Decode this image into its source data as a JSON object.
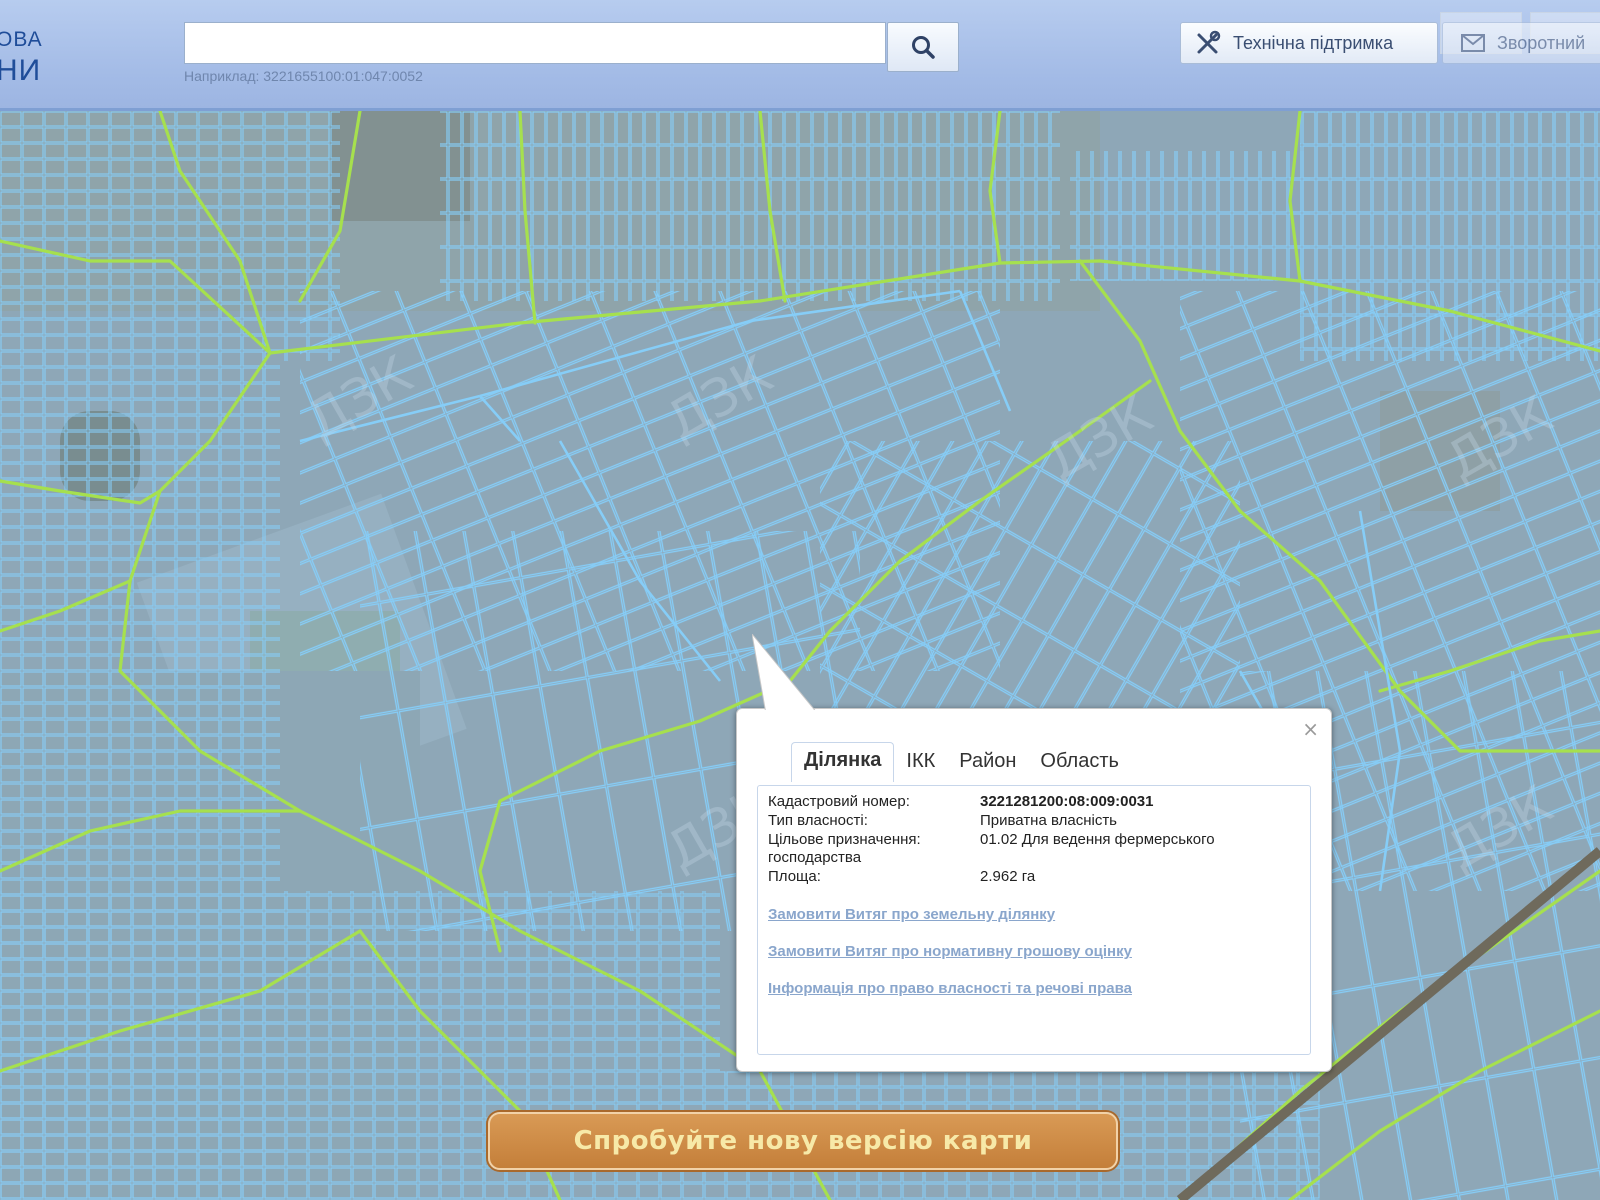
{
  "header": {
    "logo_line1": "ОВА",
    "logo_line2": "НИ",
    "search": {
      "value": "",
      "placeholder": ""
    },
    "search_hint": "Наприклад: 3221655100:01:047:0052",
    "support_label": "Технічна підтримка",
    "feedback_label": "Зворотний"
  },
  "popup": {
    "close": "×",
    "tabs": [
      {
        "label": "Ділянка",
        "active": true
      },
      {
        "label": "ІКК",
        "active": false
      },
      {
        "label": "Район",
        "active": false
      },
      {
        "label": "Область",
        "active": false
      }
    ],
    "fields": [
      {
        "label": "Кадастровий номер:",
        "value": "3221281200:08:009:0031"
      },
      {
        "label": "Тип власності:",
        "value": "Приватна власність"
      },
      {
        "label": "Цільове призначення:",
        "value": "01.02 Для ведення фермерського",
        "label_cont": "господарства"
      },
      {
        "label": "Площа:",
        "value": "2.962 га"
      }
    ],
    "links": [
      "Замовити Витяг про земельну ділянку",
      "Замовити Витяг про нормативну грошову оцінку",
      "Інформація про право власності та речові права"
    ]
  },
  "new_version_label": "Спробуйте нову версію карти",
  "colors": {
    "parcel_outline": "#7fd0ff",
    "boundary_line": "#9fe04a",
    "banner": "#c98a45"
  }
}
